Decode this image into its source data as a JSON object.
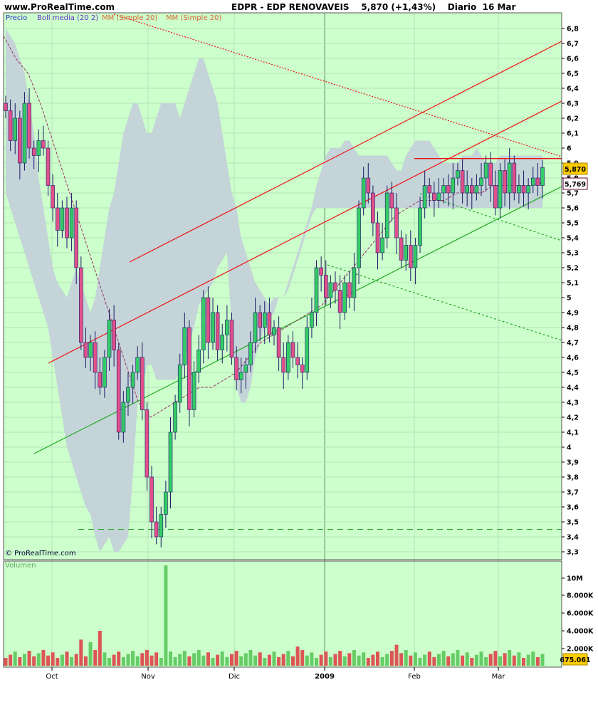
{
  "header": {
    "site": "www.ProRealTime.com",
    "title": "EDPR - EDP RENOVAVEIS",
    "quote": "5,870 (+1,43%)",
    "period": "Diario",
    "date": "16 Mar"
  },
  "legend": {
    "precio": "Precio",
    "boll": "Boll media (20 2)",
    "mm1": "MM (Simple 20)",
    "mm2": "MM (Simple 20)"
  },
  "watermark": "© ProRealTime.com",
  "volume_panel_label": "Volumen",
  "price_tag": "5,870",
  "ma_tag": "5,769",
  "volume_tag": "675.061",
  "colors": {
    "background": "#ccffcc",
    "bollinger_band": "#c4d4d8",
    "up_candle": "#33cc66",
    "down_candle": "#e0508a",
    "trendline_red": "#ee1111",
    "trendline_green": "#22aa22",
    "moving_average": "#993366"
  },
  "chart_data": [
    {
      "type": "candlestick",
      "title": "EDPR - EDP RENOVAVEIS",
      "period": "Diario",
      "last_close": 5.87,
      "change_pct": "+1,43%",
      "y_ticks": [
        "6,8",
        "6,7",
        "6,6",
        "6,5",
        "6,4",
        "6,3",
        "6,2",
        "6,1",
        "6",
        "5,9",
        "5,8",
        "5,7",
        "5,6",
        "5,5",
        "5,4",
        "5,3",
        "5,2",
        "5,1",
        "5",
        "4,9",
        "4,8",
        "4,7",
        "4,6",
        "4,5",
        "4,4",
        "4,3",
        "4,2",
        "4,1",
        "4",
        "3,9",
        "3,8",
        "3,7",
        "3,6",
        "3,5",
        "3,4",
        "3,3"
      ],
      "x_ticks": [
        "Oct",
        "Nov",
        "Dic",
        "2009",
        "Feb",
        "Mar"
      ],
      "ylim": [
        3.3,
        6.8
      ],
      "series": [
        {
          "name": "Precio",
          "close": [
            6.25,
            6.05,
            6.2,
            5.9,
            6.3,
            6.0,
            5.95,
            6.05,
            6.0,
            5.75,
            5.6,
            5.45,
            5.6,
            5.4,
            5.6,
            5.2,
            4.7,
            4.6,
            4.7,
            4.5,
            4.4,
            4.6,
            4.85,
            4.65,
            4.1,
            4.3,
            4.4,
            4.5,
            4.6,
            4.25,
            3.8,
            3.5,
            3.4,
            3.55,
            3.7,
            4.1,
            4.3,
            4.55,
            4.8,
            4.25,
            4.5,
            4.65,
            5.0,
            4.7,
            4.9,
            4.65,
            4.75,
            4.85,
            4.6,
            4.45,
            4.5,
            4.55,
            4.7,
            4.9,
            4.8,
            4.9,
            4.75,
            4.8,
            4.6,
            4.5,
            4.7,
            4.6,
            4.55,
            4.5,
            4.8,
            4.9,
            5.2,
            5.15,
            5.0,
            5.1,
            5.05,
            4.9,
            5.1,
            5.0,
            5.2,
            5.6,
            5.8,
            5.7,
            5.5,
            5.3,
            5.4,
            5.7,
            5.6,
            5.4,
            5.25,
            5.35,
            5.2,
            5.35,
            5.6,
            5.75,
            5.7,
            5.65,
            5.7,
            5.75,
            5.7,
            5.8,
            5.85,
            5.7,
            5.75,
            5.7,
            5.75,
            5.8,
            5.9,
            5.75,
            5.6,
            5.85,
            5.7,
            5.9,
            5.7,
            5.75,
            5.7,
            5.75,
            5.8,
            5.75,
            5.87
          ]
        },
        {
          "name": "Boll media (20 2)",
          "upper": [
            6.8,
            6.75,
            6.7,
            6.6,
            6.5,
            6.3,
            6.1,
            5.8,
            5.6,
            5.4,
            5.2,
            5.1,
            5.05,
            5.0,
            5.1,
            5.2,
            5.1,
            5.0,
            4.9,
            5.0,
            5.2,
            5.4,
            5.6,
            5.7,
            5.9,
            6.1,
            6.2,
            6.3,
            6.3,
            6.2,
            6.1,
            6.1,
            6.2,
            6.3,
            6.3,
            6.3,
            6.3,
            6.2,
            6.3,
            6.4,
            6.5,
            6.6,
            6.6,
            6.5,
            6.4,
            6.3,
            6.1,
            5.9,
            5.7,
            5.6,
            5.4,
            5.3,
            5.2,
            5.1,
            5.05,
            5.0,
            4.95,
            5.0,
            5.0,
            5.0,
            5.1,
            5.2,
            5.3,
            5.4,
            5.5,
            5.6,
            5.75,
            5.85,
            5.95,
            6.0,
            6.0,
            6.0,
            6.05,
            6.05,
            6.0,
            5.95,
            5.95,
            5.95,
            5.95,
            5.95,
            5.95,
            5.95,
            5.9,
            5.85,
            5.85,
            5.95,
            6.0,
            6.05,
            6.05,
            6.05,
            6.05,
            6.0,
            5.95,
            5.9,
            5.9,
            5.9,
            5.9,
            5.95,
            5.95,
            5.95,
            6.0,
            5.95,
            5.9,
            5.9,
            5.9,
            5.95,
            5.95,
            5.95,
            5.95,
            5.95,
            5.95,
            5.95,
            5.95,
            5.95,
            5.95
          ],
          "lower": [
            5.7,
            5.6,
            5.5,
            5.4,
            5.3,
            5.2,
            5.1,
            5.0,
            4.9,
            4.8,
            4.6,
            4.4,
            4.2,
            4.0,
            3.9,
            3.8,
            3.7,
            3.6,
            3.55,
            3.4,
            3.3,
            3.35,
            3.4,
            3.3,
            3.3,
            3.35,
            3.4,
            3.8,
            4.3,
            4.4,
            4.55,
            4.55,
            4.45,
            4.45,
            4.45,
            4.45,
            4.45,
            4.5,
            4.55,
            4.7,
            4.8,
            4.95,
            5.0,
            5.05,
            5.1,
            5.2,
            5.25,
            5.3,
            4.8,
            4.4,
            4.3,
            4.3,
            4.4,
            4.6,
            4.7,
            4.8,
            4.85,
            4.9,
            5.0,
            5.0,
            5.05,
            5.15,
            5.25,
            5.35,
            5.45,
            5.55,
            5.6,
            5.6,
            5.6,
            5.6,
            5.6,
            5.6,
            5.6,
            5.6,
            5.6,
            5.6,
            5.6,
            5.6,
            5.6,
            5.6,
            5.6,
            5.6,
            5.6,
            5.6,
            5.6,
            5.6,
            5.6,
            5.6,
            5.6,
            5.6,
            5.6,
            5.6,
            5.6,
            5.6,
            5.6,
            5.6,
            5.6,
            5.6,
            5.6,
            5.6,
            5.6,
            5.6,
            5.6,
            5.6,
            5.6,
            5.6,
            5.6,
            5.6,
            5.6,
            5.6,
            5.6,
            5.6,
            5.6,
            5.6,
            5.6
          ]
        },
        {
          "name": "MM (Simple 20)",
          "values": [
            6.75,
            6.6,
            6.5,
            6.3,
            6.05,
            5.8,
            5.55,
            5.3,
            5.05,
            4.8,
            4.55,
            4.3,
            4.2,
            4.25,
            4.3,
            4.35,
            4.4,
            4.4,
            4.45,
            4.5,
            4.6,
            4.7,
            4.75,
            4.8,
            4.85,
            4.9,
            4.95,
            5.05,
            5.15,
            5.25,
            5.35,
            5.45,
            5.55,
            5.6,
            5.65,
            5.65,
            5.65,
            5.7,
            5.7,
            5.7,
            5.75,
            5.75,
            5.75,
            5.75,
            5.77
          ]
        }
      ],
      "annotations": {
        "price_label": "5,870",
        "ma_label": "5,769",
        "support_level": 3.45,
        "resistance_level": 5.93
      }
    },
    {
      "type": "bar",
      "title": "Volumen",
      "y_ticks": [
        "10M",
        "8.000K",
        "6.000K",
        "4.000K",
        "2.000K"
      ],
      "ylim": [
        0,
        12000000
      ],
      "last_value": "675.061",
      "x_ticks": [
        "Oct",
        "Nov",
        "Dic",
        "2009",
        "Feb",
        "Mar"
      ]
    }
  ]
}
